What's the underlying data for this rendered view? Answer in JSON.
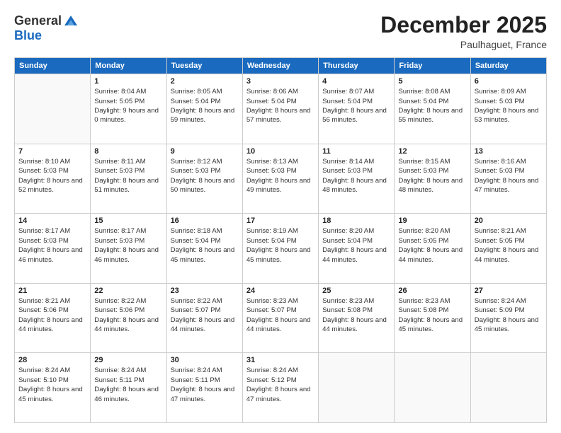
{
  "header": {
    "logo_general": "General",
    "logo_blue": "Blue",
    "month": "December 2025",
    "location": "Paulhaguet, France"
  },
  "days_of_week": [
    "Sunday",
    "Monday",
    "Tuesday",
    "Wednesday",
    "Thursday",
    "Friday",
    "Saturday"
  ],
  "weeks": [
    [
      {
        "day": "",
        "info": ""
      },
      {
        "day": "1",
        "info": "Sunrise: 8:04 AM\nSunset: 5:05 PM\nDaylight: 9 hours\nand 0 minutes."
      },
      {
        "day": "2",
        "info": "Sunrise: 8:05 AM\nSunset: 5:04 PM\nDaylight: 8 hours\nand 59 minutes."
      },
      {
        "day": "3",
        "info": "Sunrise: 8:06 AM\nSunset: 5:04 PM\nDaylight: 8 hours\nand 57 minutes."
      },
      {
        "day": "4",
        "info": "Sunrise: 8:07 AM\nSunset: 5:04 PM\nDaylight: 8 hours\nand 56 minutes."
      },
      {
        "day": "5",
        "info": "Sunrise: 8:08 AM\nSunset: 5:04 PM\nDaylight: 8 hours\nand 55 minutes."
      },
      {
        "day": "6",
        "info": "Sunrise: 8:09 AM\nSunset: 5:03 PM\nDaylight: 8 hours\nand 53 minutes."
      }
    ],
    [
      {
        "day": "7",
        "info": "Sunrise: 8:10 AM\nSunset: 5:03 PM\nDaylight: 8 hours\nand 52 minutes."
      },
      {
        "day": "8",
        "info": "Sunrise: 8:11 AM\nSunset: 5:03 PM\nDaylight: 8 hours\nand 51 minutes."
      },
      {
        "day": "9",
        "info": "Sunrise: 8:12 AM\nSunset: 5:03 PM\nDaylight: 8 hours\nand 50 minutes."
      },
      {
        "day": "10",
        "info": "Sunrise: 8:13 AM\nSunset: 5:03 PM\nDaylight: 8 hours\nand 49 minutes."
      },
      {
        "day": "11",
        "info": "Sunrise: 8:14 AM\nSunset: 5:03 PM\nDaylight: 8 hours\nand 48 minutes."
      },
      {
        "day": "12",
        "info": "Sunrise: 8:15 AM\nSunset: 5:03 PM\nDaylight: 8 hours\nand 48 minutes."
      },
      {
        "day": "13",
        "info": "Sunrise: 8:16 AM\nSunset: 5:03 PM\nDaylight: 8 hours\nand 47 minutes."
      }
    ],
    [
      {
        "day": "14",
        "info": "Sunrise: 8:17 AM\nSunset: 5:03 PM\nDaylight: 8 hours\nand 46 minutes."
      },
      {
        "day": "15",
        "info": "Sunrise: 8:17 AM\nSunset: 5:03 PM\nDaylight: 8 hours\nand 46 minutes."
      },
      {
        "day": "16",
        "info": "Sunrise: 8:18 AM\nSunset: 5:04 PM\nDaylight: 8 hours\nand 45 minutes."
      },
      {
        "day": "17",
        "info": "Sunrise: 8:19 AM\nSunset: 5:04 PM\nDaylight: 8 hours\nand 45 minutes."
      },
      {
        "day": "18",
        "info": "Sunrise: 8:20 AM\nSunset: 5:04 PM\nDaylight: 8 hours\nand 44 minutes."
      },
      {
        "day": "19",
        "info": "Sunrise: 8:20 AM\nSunset: 5:05 PM\nDaylight: 8 hours\nand 44 minutes."
      },
      {
        "day": "20",
        "info": "Sunrise: 8:21 AM\nSunset: 5:05 PM\nDaylight: 8 hours\nand 44 minutes."
      }
    ],
    [
      {
        "day": "21",
        "info": "Sunrise: 8:21 AM\nSunset: 5:06 PM\nDaylight: 8 hours\nand 44 minutes."
      },
      {
        "day": "22",
        "info": "Sunrise: 8:22 AM\nSunset: 5:06 PM\nDaylight: 8 hours\nand 44 minutes."
      },
      {
        "day": "23",
        "info": "Sunrise: 8:22 AM\nSunset: 5:07 PM\nDaylight: 8 hours\nand 44 minutes."
      },
      {
        "day": "24",
        "info": "Sunrise: 8:23 AM\nSunset: 5:07 PM\nDaylight: 8 hours\nand 44 minutes."
      },
      {
        "day": "25",
        "info": "Sunrise: 8:23 AM\nSunset: 5:08 PM\nDaylight: 8 hours\nand 44 minutes."
      },
      {
        "day": "26",
        "info": "Sunrise: 8:23 AM\nSunset: 5:08 PM\nDaylight: 8 hours\nand 45 minutes."
      },
      {
        "day": "27",
        "info": "Sunrise: 8:24 AM\nSunset: 5:09 PM\nDaylight: 8 hours\nand 45 minutes."
      }
    ],
    [
      {
        "day": "28",
        "info": "Sunrise: 8:24 AM\nSunset: 5:10 PM\nDaylight: 8 hours\nand 45 minutes."
      },
      {
        "day": "29",
        "info": "Sunrise: 8:24 AM\nSunset: 5:11 PM\nDaylight: 8 hours\nand 46 minutes."
      },
      {
        "day": "30",
        "info": "Sunrise: 8:24 AM\nSunset: 5:11 PM\nDaylight: 8 hours\nand 47 minutes."
      },
      {
        "day": "31",
        "info": "Sunrise: 8:24 AM\nSunset: 5:12 PM\nDaylight: 8 hours\nand 47 minutes."
      },
      {
        "day": "",
        "info": ""
      },
      {
        "day": "",
        "info": ""
      },
      {
        "day": "",
        "info": ""
      }
    ]
  ]
}
